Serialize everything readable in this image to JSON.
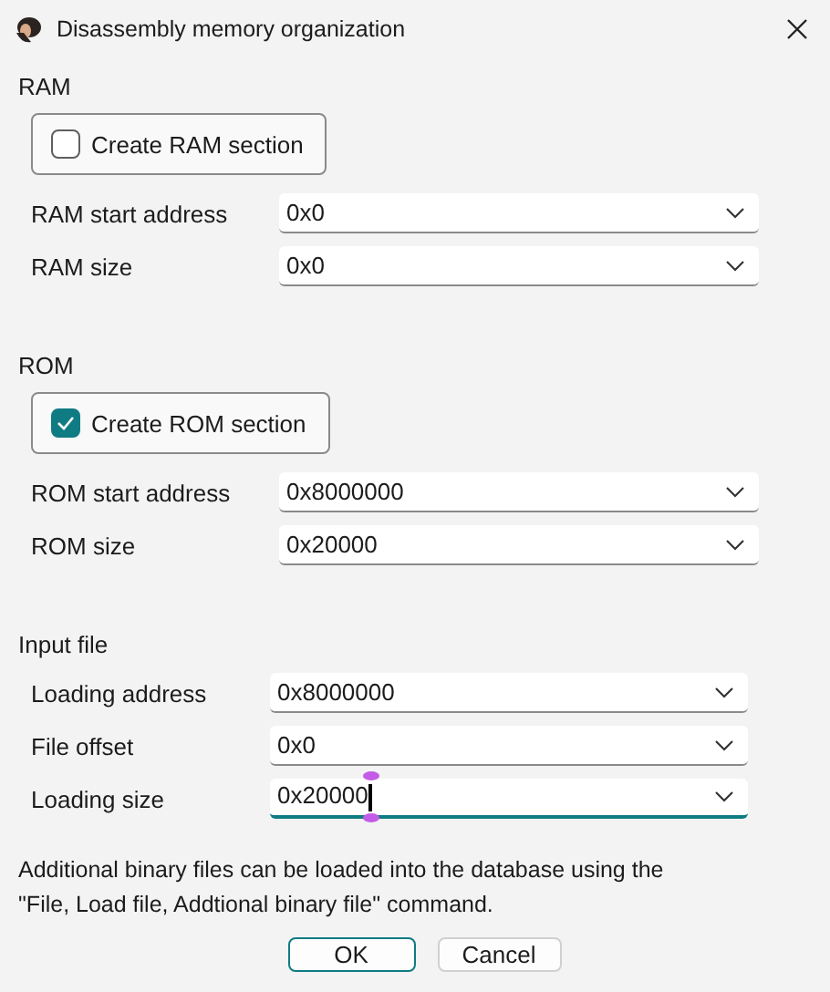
{
  "window": {
    "title": "Disassembly memory organization"
  },
  "sections": [
    {
      "title": "RAM",
      "checkbox": {
        "label": "Create RAM section",
        "checked": false
      },
      "fields": [
        {
          "label": "RAM start address",
          "value": "0x0",
          "focused": false
        },
        {
          "label": "RAM size",
          "value": "0x0",
          "focused": false
        }
      ]
    },
    {
      "title": "ROM",
      "checkbox": {
        "label": "Create ROM section",
        "checked": true
      },
      "fields": [
        {
          "label": "ROM start address",
          "value": "0x8000000",
          "focused": false
        },
        {
          "label": "ROM size",
          "value": "0x20000",
          "focused": false
        }
      ]
    },
    {
      "title": "Input file",
      "fields": [
        {
          "label": "Loading address",
          "value": "0x8000000",
          "focused": false
        },
        {
          "label": "File offset",
          "value": "0x0",
          "focused": false
        },
        {
          "label": "Loading size",
          "value": "0x20000",
          "focused": true
        }
      ]
    }
  ],
  "note": "Additional binary files can be loaded into the database using the \"File, Load file, Addtional binary file\" command.",
  "buttons": [
    {
      "label": "OK",
      "default": true
    },
    {
      "label": "Cancel",
      "default": false
    }
  ]
}
